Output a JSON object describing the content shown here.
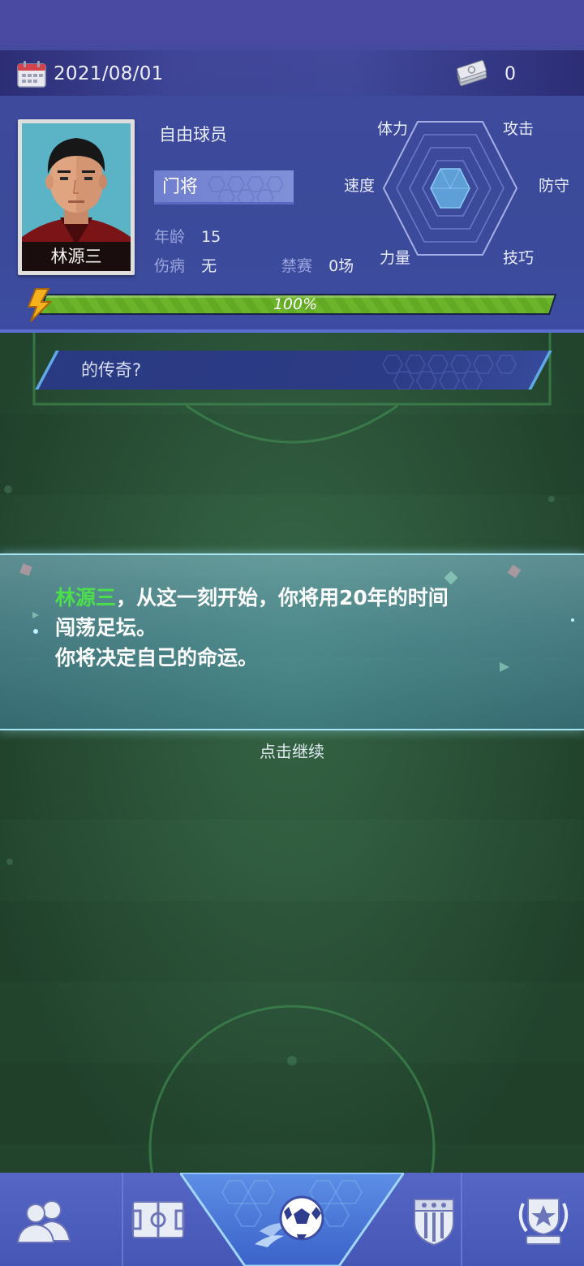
{
  "header": {
    "date": "2021/08/01",
    "money": "0",
    "player": {
      "name": "林源三",
      "status": "自由球员",
      "position": "门将",
      "age_label": "年龄",
      "age": "15",
      "injury_label": "伤病",
      "injury": "无",
      "suspension_label": "禁赛",
      "suspension": "0场"
    },
    "radar_labels": {
      "stamina": "体力",
      "attack": "攻击",
      "speed": "速度",
      "defense": "防守",
      "strength": "力量",
      "skill": "技巧"
    },
    "stamina_bar": {
      "text": "100%",
      "fraction": 1.0
    }
  },
  "banner": {
    "text": "的传奇?"
  },
  "dialog": {
    "highlight_name": "林源三",
    "line1_rest": "，从这一刻开始，你将用20年的时间",
    "line2": "闯荡足坛。",
    "line3": "你将决定自己的命运。"
  },
  "continue_label": "点击继续",
  "nav": {
    "items": [
      {
        "icon": "team-icon"
      },
      {
        "icon": "pitch-icon"
      },
      {
        "icon": "football-icon",
        "active": true
      },
      {
        "icon": "club-badge-icon"
      },
      {
        "icon": "trophy-icon"
      }
    ]
  },
  "colors": {
    "header_bg": "#3e4a9c",
    "highlight_green": "#4be04b",
    "stamina_green": "#6cb52a",
    "dialog_border": "#a9e4f5",
    "nav_bg": "#5566c4"
  }
}
